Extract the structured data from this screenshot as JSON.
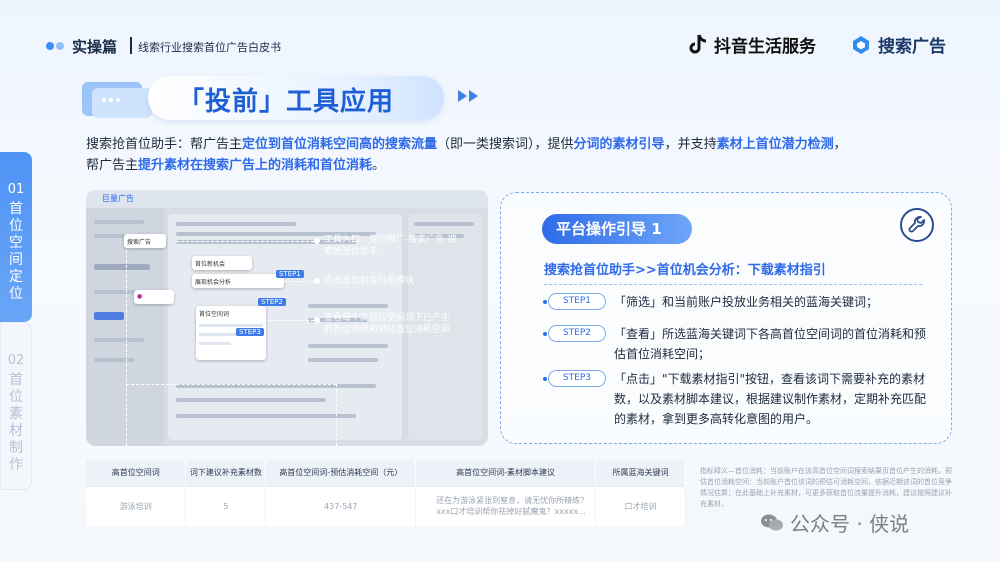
{
  "header": {
    "title": "实操篇",
    "subtitle": "线索行业搜索首位广告白皮书",
    "brand_douyin": "抖音生活服务",
    "brand_search": "搜索广告"
  },
  "banner": {
    "title": "「投前」工具应用"
  },
  "intro": {
    "p1": "搜索抢首位助手：帮广告主",
    "h1": "定位到首位消耗空间高的搜索流量",
    "p2": "（即一类搜索词），提供",
    "h2": "分词的素材引导",
    "p3": "，并支持",
    "h3": "素材上首位潜力检测",
    "p4": "，",
    "p5": "帮广告主",
    "h4": "提升素材在搜索广告上的消耗和首位消耗",
    "p6": "。"
  },
  "side_tabs": [
    {
      "num": "01",
      "label": "首位空间定位"
    },
    {
      "num": "02",
      "label": "首位素材制作"
    }
  ],
  "screenshot": {
    "brand": "巨量广告",
    "card1": "搜索广告",
    "card2": "首位新机会",
    "card3": "展现机会分析",
    "card4": "首位空间词",
    "step1": "STEP1",
    "step2": "STEP2",
    "step3": "STEP3",
    "notes": [
      "工具入口：竞价推广-搜索广告-搜索抢首位助手",
      "点击首位机会分析模块",
      "查看每个高首位空间词下已产生的首位消耗和预估首位消耗空间"
    ]
  },
  "guide": {
    "pill": "平台操作引导 1",
    "subtitle": "搜索抢首位助手>>首位机会分析：下载素材指引",
    "steps": [
      {
        "badge": "STEP1",
        "text": "「筛选」和当前账户投放业务相关的蓝海关键词；"
      },
      {
        "badge": "STEP2",
        "text": "「查看」所选蓝海关键词下各高首位空间词的首位消耗和预估首位消耗空间；"
      },
      {
        "badge": "STEP3",
        "text": "「点击」\"下载素材指引\"按钮，查看该词下需要补充的素材数，以及素材脚本建议，根据建议制作素材，定期补充匹配的素材，拿到更多高转化意图的用户。"
      }
    ]
  },
  "table": {
    "headers": [
      "高首位空间词",
      "词下建议补充素材数",
      "高首位空间词-预估消耗空间（元）",
      "高首位空间词-素材脚本建议",
      "所属蓝海关键词"
    ],
    "rows": [
      [
        "游泳培训",
        "5",
        "437-547",
        "还在为游泳紧张到窒息，请无忧你所精练？xxx口才培训帮你祛掉好腻魔鬼？xxxxx...",
        "口才培训"
      ]
    ]
  },
  "footnote": "指标释义—首位消耗：当前账户在该高首位空间词搜索结果页首位产生的消耗，预估首位消耗空间：当前账户首位该词的预估可消耗空间，依据近期该词的首位竞争情况估算；在此基础上补充素材，可更多获取首位流量提升消耗，建议按照建议补充素材。",
  "watermark": "公众号 · 侠说",
  "colors": {
    "accent": "#2f6be8",
    "tab_active": "#4f93f5"
  }
}
